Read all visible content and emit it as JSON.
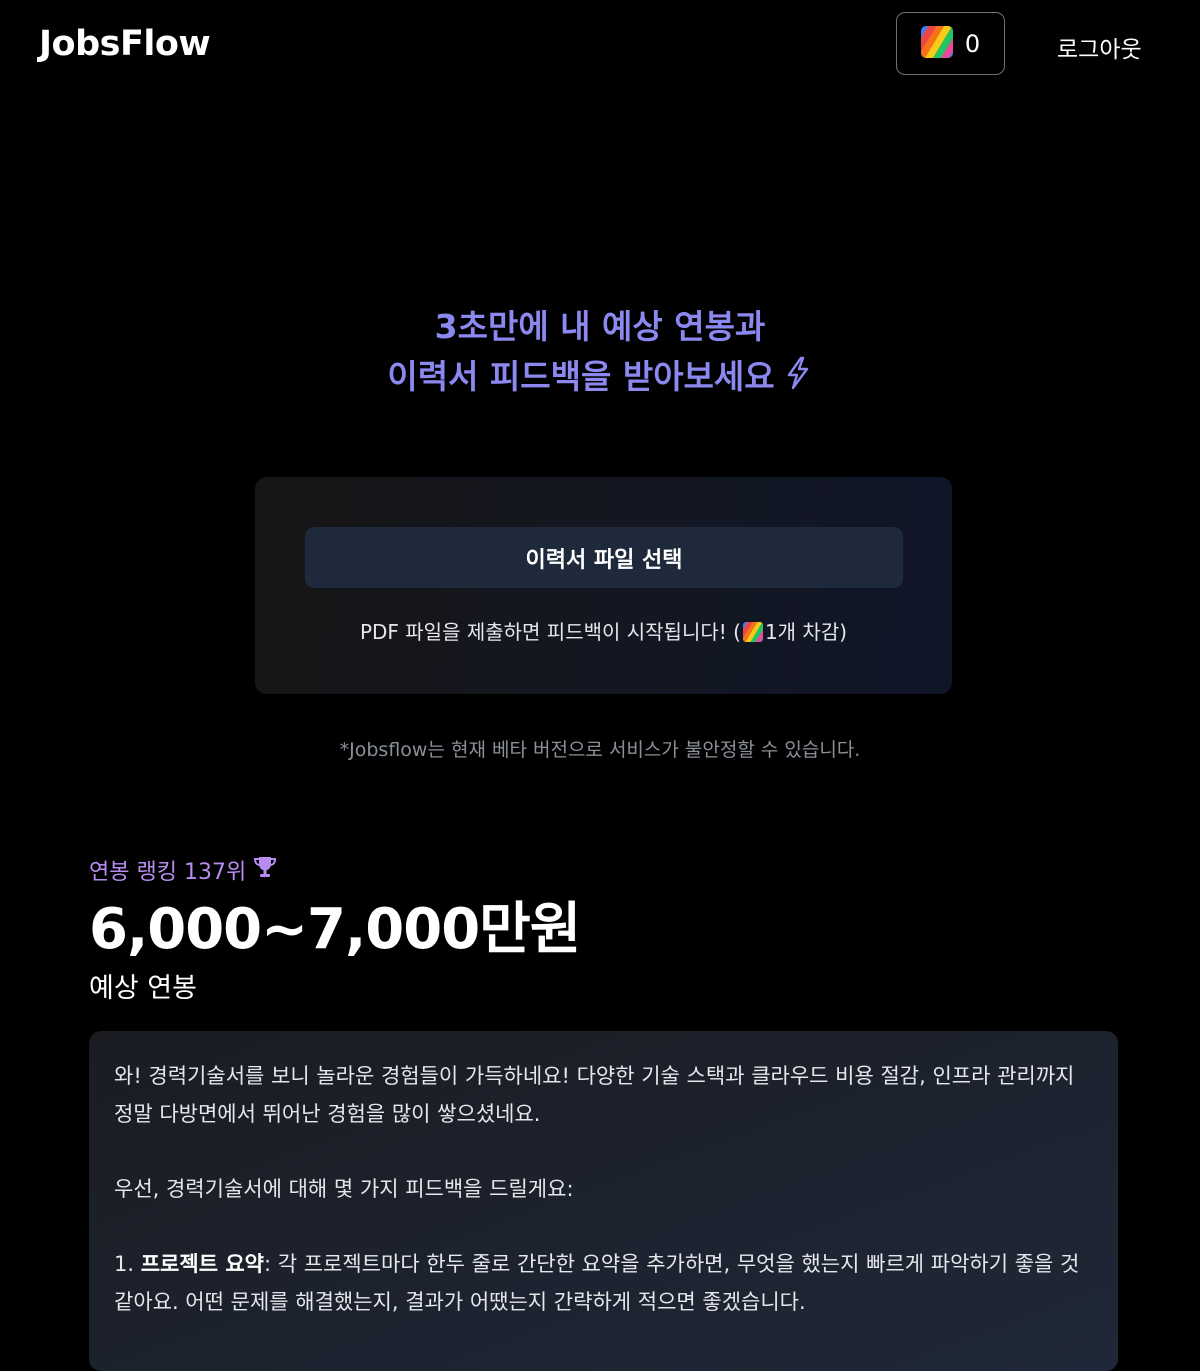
{
  "header": {
    "logo": "JobsFlow",
    "credits": "0",
    "logout_label": "로그아웃"
  },
  "hero": {
    "line1": "3초만에 내 예상 연봉과",
    "line2": "이력서 피드백을 받아보세요"
  },
  "upload": {
    "button_label": "이력서 파일 선택",
    "hint_prefix": "PDF 파일을 제출하면 피드백이 시작됩니다! (",
    "hint_suffix": "1개 차감)"
  },
  "beta_note": "*Jobsflow는 현재 베타 버전으로 서비스가 불안정할 수 있습니다.",
  "result": {
    "ranking": "연봉 랭킹 137위",
    "salary": "6,000~7,000만원",
    "salary_label": "예상 연봉"
  },
  "feedback": {
    "intro": "와! 경력기술서를 보니 놀라운 경험들이 가득하네요! 다양한 기술 스택과 클라우드 비용 절감, 인프라 관리까지 정말 다방면에서 뛰어난 경험을 많이 쌓으셨네요.",
    "lead": "우선, 경력기술서에 대해 몇 가지 피드백을 드릴게요:",
    "item1_number": "1.",
    "item1_title": "프로젝트 요약",
    "item1_text": ": 각 프로젝트마다 한두 줄로 간단한 요약을 추가하면, 무엇을 했는지 빠르게 파악하기 좋을 것 같아요. 어떤 문제를 해결했는지, 결과가 어땠는지 간략하게 적으면 좋겠습니다."
  },
  "colors": {
    "accent_purple": "#8b88f0",
    "ranking_purple": "#b68cf0",
    "button_bg": "#1e293b"
  },
  "icons": {
    "credit": "rainbow-stripes-icon",
    "hero": "lightning-bolt-icon",
    "ranking": "trophy-icon"
  }
}
